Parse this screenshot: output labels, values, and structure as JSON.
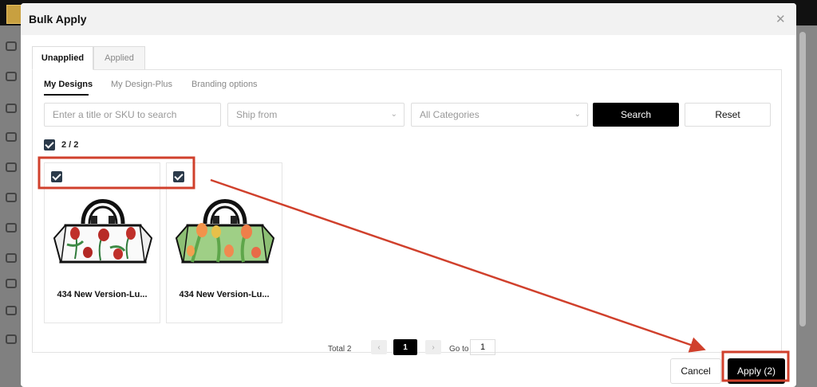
{
  "modal": {
    "title": "Bulk Apply",
    "close_icon": "close-icon",
    "tabs": [
      {
        "label": "Unapplied",
        "active": true
      },
      {
        "label": "Applied",
        "active": false
      }
    ],
    "subtabs": [
      {
        "label": "My Designs",
        "active": true
      },
      {
        "label": "My Design-Plus",
        "active": false
      },
      {
        "label": "Branding options",
        "active": false
      }
    ]
  },
  "filters": {
    "search_placeholder": "Enter a title or SKU to search",
    "ship_from_placeholder": "Ship from",
    "category_placeholder": "All Categories",
    "search_label": "Search",
    "reset_label": "Reset"
  },
  "selection": {
    "count_label": "2 / 2",
    "all_checked": true
  },
  "products": [
    {
      "name": "434 New Version-Lu...",
      "checked": true,
      "pattern": "white-red-tulips"
    },
    {
      "name": "434 New Version-Lu...",
      "checked": true,
      "pattern": "green-orange-tulips"
    }
  ],
  "pagination": {
    "total_label": "Total 2",
    "current_page": "1",
    "goto_label": "Go to",
    "goto_value": "1"
  },
  "footer": {
    "cancel_label": "Cancel",
    "apply_label": "Apply (2)"
  },
  "colors": {
    "primary": "#000000",
    "checkbox": "#2b3a4a",
    "annotation": "#d0402c"
  }
}
